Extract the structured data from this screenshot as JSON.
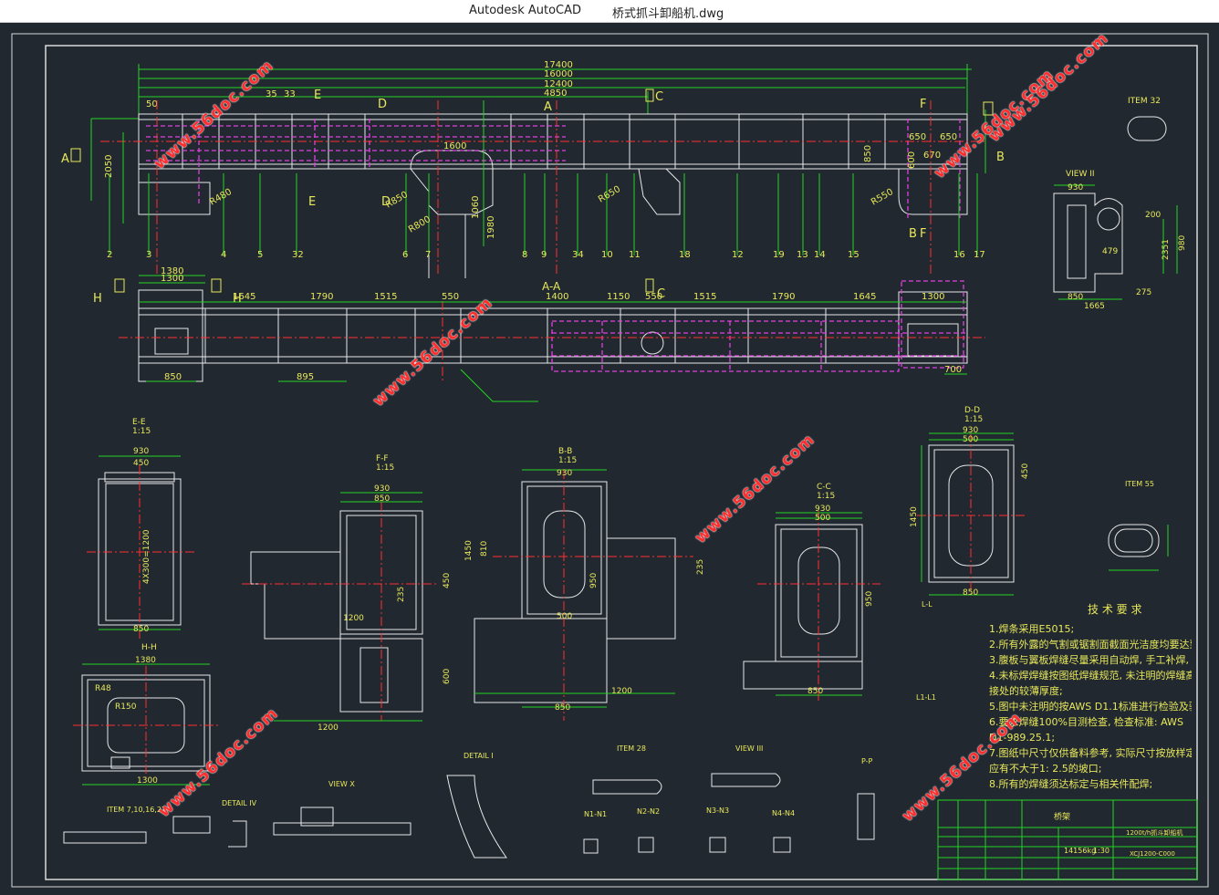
{
  "window": {
    "app_name": "Autodesk AutoCAD",
    "file_name": "桥式抓斗卸船机.dwg"
  },
  "watermark": "www.56doc.com",
  "colors": {
    "background": "#212830",
    "frame": "#d9d9d9",
    "outline": "#e8e8e8",
    "dimension": "#22d422",
    "center": "#ff3030",
    "hidden": "#e040e0",
    "text": "#e8e85a"
  },
  "main_view": {
    "dims_top": [
      "17400",
      "16000",
      "12400",
      "4850"
    ],
    "dims_left": [
      "50",
      "35",
      "33",
      "1600",
      "670",
      "650",
      "650"
    ],
    "section_marks": [
      "A",
      "B",
      "C",
      "D",
      "E",
      "F"
    ],
    "bottom_numbers": [
      "2",
      "3",
      "4",
      "5",
      "32",
      "6",
      "7",
      "8",
      "9",
      "34",
      "10",
      "11",
      "18",
      "12",
      "19",
      "13",
      "14",
      "15",
      "16",
      "17"
    ],
    "vertical_dims": [
      "2050",
      "1060",
      "1980",
      "600",
      "850"
    ],
    "radii": [
      "R850",
      "R800",
      "R650",
      "R550",
      "R480"
    ]
  },
  "plan_view": {
    "label": "A-A",
    "dims": [
      "1645",
      "1790",
      "1515",
      "550",
      "1400",
      "1150",
      "550",
      "1515",
      "1790",
      "1645",
      "1300",
      "1380",
      "1300",
      "895",
      "850",
      "700"
    ],
    "marks": [
      "H",
      "H",
      "C"
    ]
  },
  "section_views": [
    {
      "title": "E-E",
      "scale": "1:15",
      "dims": [
        "930",
        "450",
        "4X300=1200",
        "850",
        "40",
        "12"
      ]
    },
    {
      "title": "F-F",
      "scale": "1:15",
      "dims": [
        "930",
        "850",
        "1200",
        "1200",
        "600",
        "450",
        "235"
      ]
    },
    {
      "title": "B-B",
      "scale": "1:15",
      "dims": [
        "930",
        "500",
        "1450",
        "810",
        "850",
        "1200",
        "950",
        "235"
      ]
    },
    {
      "title": "C-C",
      "scale": "1:15",
      "dims": [
        "930",
        "500",
        "850",
        "950",
        "250",
        "1450"
      ]
    },
    {
      "title": "D-D",
      "scale": "1:15",
      "dims": [
        "930",
        "500",
        "1450",
        "850",
        "450",
        "230"
      ]
    },
    {
      "title": "H-H",
      "scale": "1:15",
      "dims": [
        "1380",
        "1300",
        "930",
        "R48",
        "R150"
      ]
    },
    {
      "title": "VIEW II",
      "scale": "",
      "dims": [
        "930",
        "200",
        "479",
        "1665",
        "850",
        "275",
        "980",
        "2351"
      ]
    }
  ],
  "details": [
    "ITEM 32",
    "ITEM 55",
    "DETAIL I",
    "ITEM 28",
    "VIEW III",
    "VIEW X",
    "DETAIL IV",
    "ITEM 7,10,16,27",
    "P-P",
    "L-L",
    "L1-L1",
    "N1-N1",
    "N2-N2",
    "N3-N3",
    "N4-N4"
  ],
  "tech_notes": {
    "title": "技 术 要 求",
    "lines": [
      "1.焊条采用E5015;",
      "2.所有外露的气割或锯割面截面光洁度均要达到低级或磨平;",
      "3.腹板与翼板焊缝尽量采用自动焊, 手工补焊, 坡口达标准规定;",
      "4.未标焊焊缝按图纸焊缝规范, 未注明的焊缝高度取0.7倍的板连",
      "接处的较薄厚度;",
      "5.图中未注明的按AWS D1.1标准进行检验及验收;",
      "6.要求焊缝100%目测检查, 检查标准: AWS",
      "D1-989.25.1;",
      "7.图纸中尺寸仅供备料参考, 实际尺寸按放样定, 几何焊缝板对接缝",
      "应有不大于1: 2.5的坡口;",
      "8.所有的焊缝须达标定与相关件配焊;"
    ]
  },
  "title_block": {
    "name": "桥架",
    "description": "1200t/h抓斗卸船机",
    "weight": "14156kg",
    "scale": "1:30",
    "drawing_no": "XCJ1200-C000"
  }
}
